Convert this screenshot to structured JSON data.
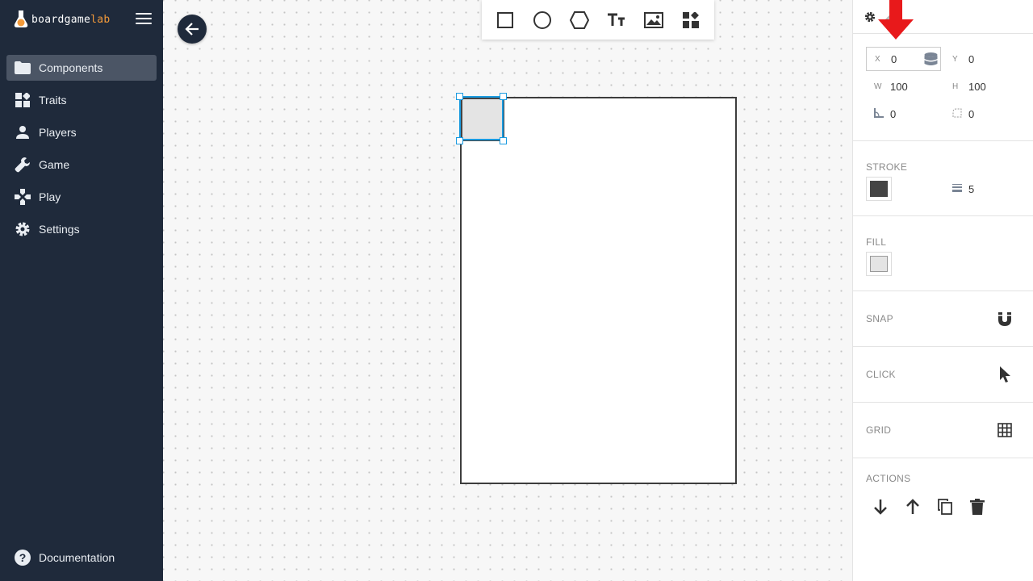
{
  "brand": {
    "name_main": "boardgame",
    "name_accent": "lab"
  },
  "sidebar": {
    "items": [
      {
        "label": "Components",
        "icon": "folder-icon",
        "active": true
      },
      {
        "label": "Traits",
        "icon": "traits-icon"
      },
      {
        "label": "Players",
        "icon": "person-icon"
      },
      {
        "label": "Game",
        "icon": "wrench-icon"
      },
      {
        "label": "Play",
        "icon": "gamepad-icon"
      },
      {
        "label": "Settings",
        "icon": "gear-icon"
      }
    ],
    "documentation": "Documentation"
  },
  "toolbar": {
    "tools": [
      "rectangle-tool",
      "circle-tool",
      "hexagon-tool",
      "text-tool",
      "image-tool",
      "widget-tool"
    ]
  },
  "panel": {
    "position": {
      "x_label": "X",
      "x_value": "0",
      "y_label": "Y",
      "y_value": "0"
    },
    "size": {
      "w_label": "W",
      "w_value": "100",
      "h_label": "H",
      "h_value": "100"
    },
    "angle": {
      "rotation_value": "0",
      "radius_value": "0"
    },
    "stroke": {
      "label": "STROKE",
      "color": "#444444",
      "width": "5"
    },
    "fill": {
      "label": "FILL",
      "color": "#e4e4e4"
    },
    "snap": {
      "label": "SNAP"
    },
    "click": {
      "label": "CLICK"
    },
    "grid": {
      "label": "GRID"
    },
    "actions": {
      "label": "ACTIONS"
    }
  },
  "colors": {
    "sidebar_bg": "#1f2a3b",
    "active_item": "#4b5565",
    "selection": "#1a9be0",
    "brand_accent": "#f39a3a",
    "annotation_arrow": "#e8191b"
  }
}
